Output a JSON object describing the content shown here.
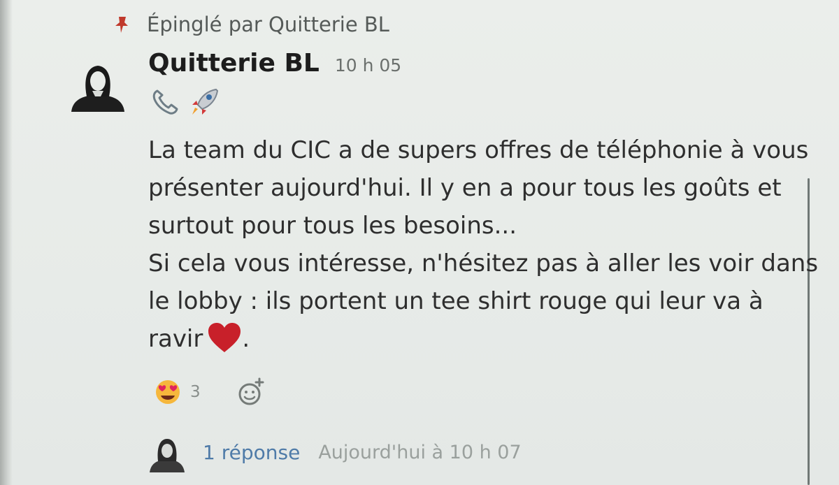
{
  "pinned": {
    "text": "Épinglé par Quitterie BL",
    "icon": "pin-icon",
    "icon_color": "#c0392b"
  },
  "message": {
    "author": "Quitterie BL",
    "time": "10 h 05",
    "status_icons": [
      "phone-icon",
      "rocket-icon"
    ],
    "lines": [
      "La team du CIC a de supers offres de téléphonie à vous",
      "présenter aujourd'hui. Il y en a pour tous les goûts et",
      "surtout pour tous les besoins...",
      "Si cela vous intéresse, n'hésitez pas à aller les voir dans",
      "le lobby : ils portent un tee shirt rouge  qui leur va à",
      "ravir"
    ],
    "end_emoji": "heart-icon",
    "end_text": "."
  },
  "reactions": [
    {
      "emoji": "heart-eyes-emoji-icon",
      "count": "3"
    }
  ],
  "add_reaction_icon": "add-reaction-icon",
  "thread": {
    "reply_label": "1 réponse",
    "last_reply": "Aujourd'hui à 10 h 07"
  },
  "colors": {
    "link": "#4f7ba8",
    "heart": "#c8202a",
    "muted": "#9aa09d"
  }
}
